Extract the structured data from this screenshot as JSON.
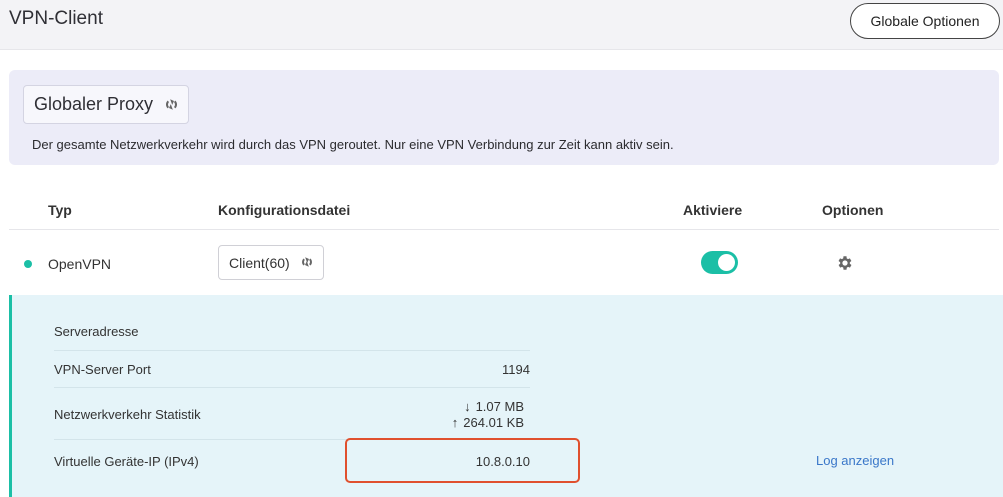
{
  "app": {
    "title": "VPN-Client"
  },
  "header": {
    "global_options_label": "Globale Optionen"
  },
  "proxy": {
    "mode_label": "Globaler Proxy",
    "description": "Der gesamte Netzwerkverkehr wird durch das VPN geroutet. Nur eine VPN Verbindung zur Zeit kann aktiv sein."
  },
  "table": {
    "columns": {
      "type": "Typ",
      "config": "Konfigurationsdatei",
      "activate": "Aktiviere",
      "options": "Optionen"
    },
    "row": {
      "type": "OpenVPN",
      "config": "Client(60)",
      "active": true,
      "status_color": "#1bbfa6"
    }
  },
  "details": {
    "server_address_label": "Serveradresse",
    "server_address_value": "",
    "port_label": "VPN-Server Port",
    "port_value": "1194",
    "traffic_label": "Netzwerkverkehr Statistik",
    "traffic_down_icon": "arrow-down",
    "traffic_down": "1.07 MB",
    "traffic_up_icon": "arrow-up",
    "traffic_up": "264.01 KB",
    "ip_label": "Virtuelle Geräte-IP (IPv4)",
    "ip_value": "10.8.0.10",
    "log_link": "Log anzeigen"
  },
  "colors": {
    "accent": "#1bbfa6",
    "highlight": "#e0502e",
    "link": "#3a77c9"
  }
}
